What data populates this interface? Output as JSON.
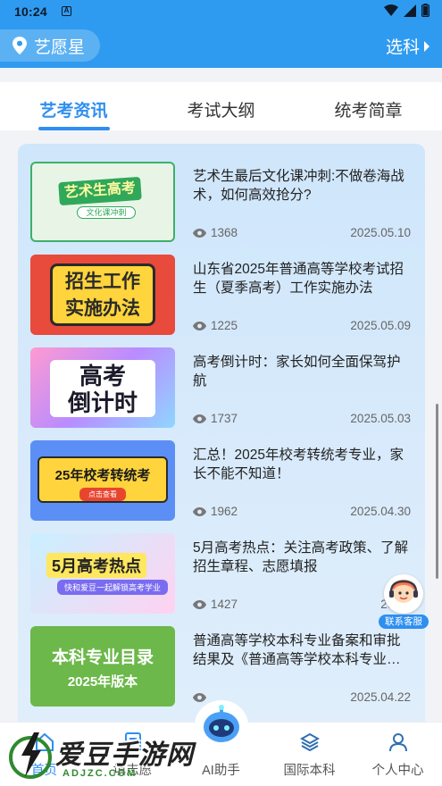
{
  "status_bar": {
    "time": "10:24",
    "notification_badge": "A"
  },
  "header": {
    "location_label": "艺愿星",
    "select_subject_label": "选科",
    "colors": {
      "primary": "#2f9bf0"
    }
  },
  "tabs": [
    {
      "label": "艺考资讯",
      "active": true
    },
    {
      "label": "考试大纲",
      "active": false
    },
    {
      "label": "统考简章",
      "active": false
    }
  ],
  "articles": [
    {
      "title": "艺术生最后文化课冲刺:不做卷海战术，如何高效抢分?",
      "views": "1368",
      "date": "2025.05.10",
      "thumb_text": [
        "艺术生高考",
        "文化课冲刺"
      ]
    },
    {
      "title": "山东省2025年普通高等学校考试招生（夏季高考）工作实施办法",
      "views": "1225",
      "date": "2025.05.09",
      "thumb_text": [
        "招生工作",
        "实施办法"
      ]
    },
    {
      "title": "高考倒计时：家长如何全面保驾护航",
      "views": "1737",
      "date": "2025.05.03",
      "thumb_text": [
        "高考",
        "倒计时"
      ]
    },
    {
      "title": "汇总！2025年校考转统考专业，家长不能不知道！",
      "views": "1962",
      "date": "2025.04.30",
      "thumb_text": [
        "25年校考转统考",
        "点击查看"
      ]
    },
    {
      "title": "5月高考热点：关注高考政策、了解招生章程、志愿填报",
      "views": "1427",
      "date": "2025.",
      "thumb_text": [
        "5月高考热点",
        "快和爱豆一起解锁高考学业"
      ]
    },
    {
      "title": "普通高等学校本科专业备案和审批结果及《普通高等学校本科专业目录》",
      "views": "",
      "date": "2025.04.22",
      "thumb_text": [
        "本科专业目录",
        "2025年版本"
      ]
    }
  ],
  "customer_service": {
    "label": "联系客服"
  },
  "bottom_nav": [
    {
      "label": "首页",
      "icon": "home-icon",
      "active": true
    },
    {
      "label": "填志愿",
      "icon": "form-icon",
      "active": false
    },
    {
      "label": "AI助手",
      "icon": "robot-icon",
      "active": false
    },
    {
      "label": "国际本科",
      "icon": "layers-icon",
      "active": false
    },
    {
      "label": "个人中心",
      "icon": "user-icon",
      "active": false
    }
  ],
  "watermark": {
    "text": "爱豆手游网",
    "url": "ADJZC.COM"
  }
}
